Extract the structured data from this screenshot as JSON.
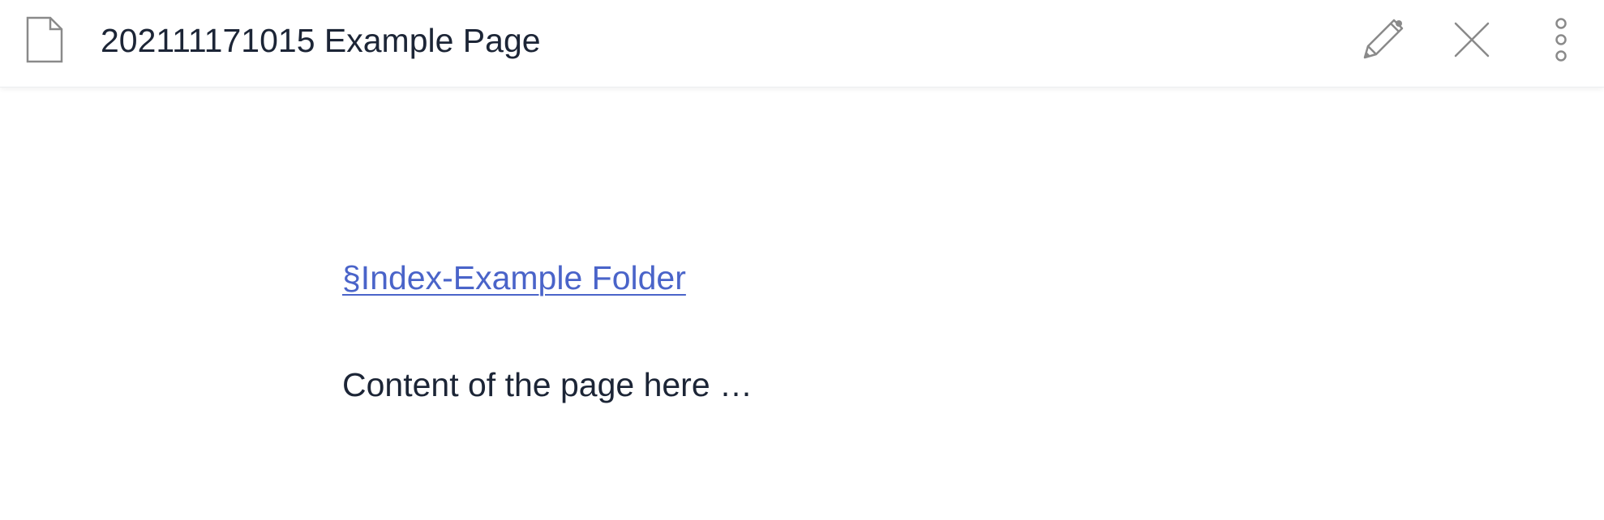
{
  "header": {
    "title": "202111171015 Example Page",
    "page_icon": "document-icon",
    "actions": [
      {
        "name": "edit",
        "icon": "pencil-icon"
      },
      {
        "name": "close",
        "icon": "close-icon"
      },
      {
        "name": "more",
        "icon": "more-vertical-icon"
      }
    ]
  },
  "main": {
    "link_text": "§Index-Example Folder",
    "body_text": "Content of the page here …"
  },
  "colors": {
    "text": "#1c2536",
    "link": "#4a64c9",
    "icon": "#8a8a8a"
  }
}
